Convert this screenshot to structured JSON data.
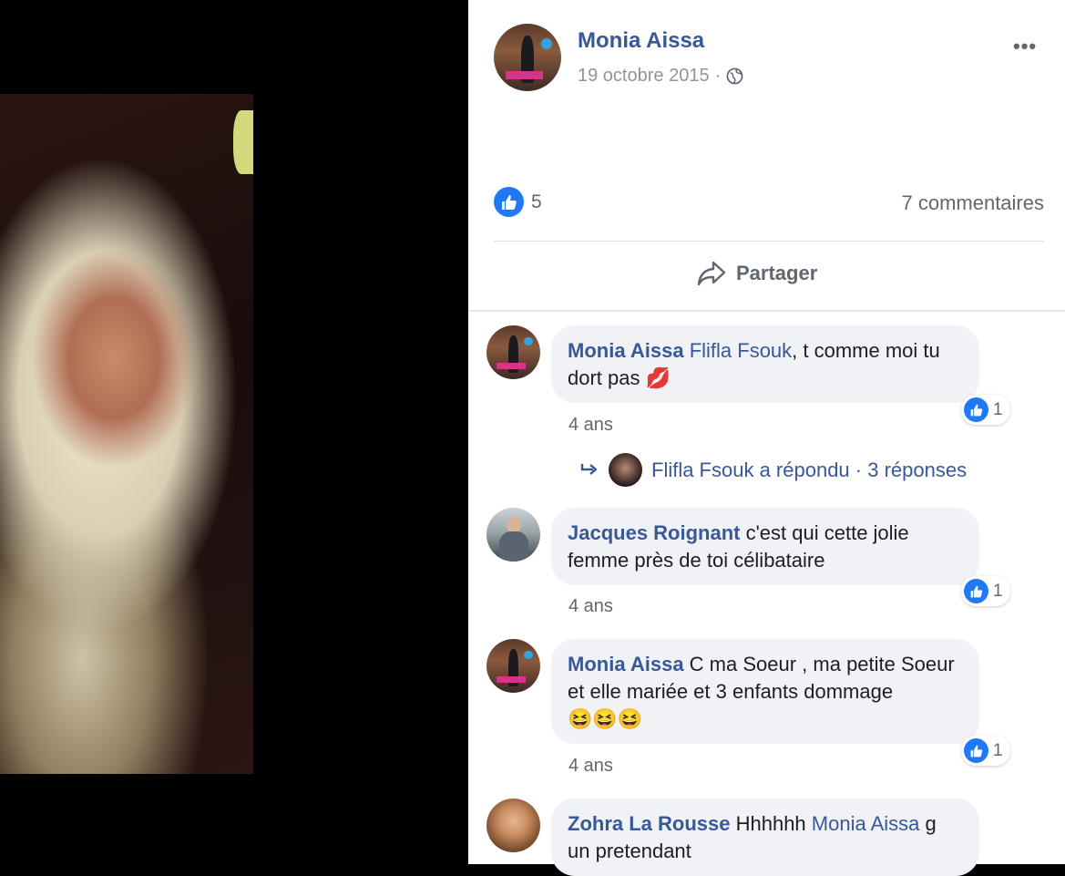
{
  "post": {
    "author": "Monia Aissa",
    "date": "19 octobre 2015",
    "separator": "·",
    "privacy_icon": "globe-icon",
    "more_icon": "•••",
    "like_count": "5",
    "comments_count": "7 commentaires",
    "share_label": "Partager"
  },
  "comments": [
    {
      "name": "Monia Aissa",
      "mention": "Flifla Fsouk",
      "text": ", t comme moi tu dort pas ",
      "emoji": "💋",
      "reactions": "1",
      "time": "4 ans",
      "reply": {
        "text": "Flifla Fsouk a répondu · 3 réponses"
      }
    },
    {
      "name": "Jacques Roignant",
      "text": " c'est qui cette jolie femme près de toi célibataire",
      "reactions": "1",
      "time": "4 ans"
    },
    {
      "name": "Monia Aissa",
      "text": " C ma Soeur , ma petite Soeur et elle mariée et 3 enfants dommage ",
      "emoji": "😆😆😆",
      "reactions": "1",
      "time": "4 ans"
    },
    {
      "name": "Zohra La Rousse",
      "text_before": " Hhhhhh ",
      "mention": "Monia Aissa",
      "text_after": " g un pretendant"
    }
  ],
  "colors": {
    "link": "#385898",
    "like_blue": "#2078f4",
    "bubble_bg": "#f0f2f5",
    "muted": "#606770"
  }
}
